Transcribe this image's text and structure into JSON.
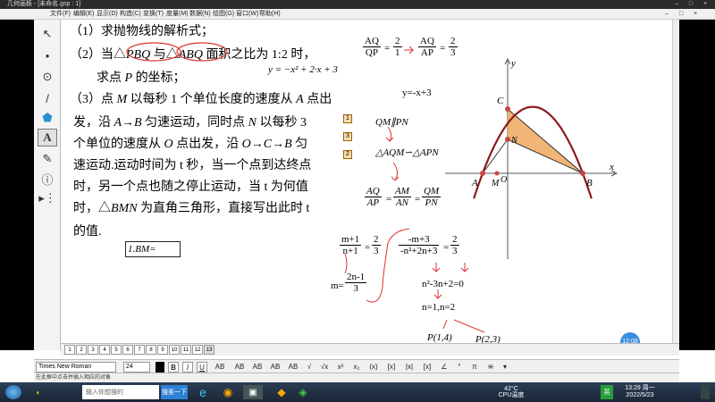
{
  "window": {
    "title": "几何画板 - [未命名.gsp : 1]",
    "controls": [
      "–",
      "□",
      "×"
    ]
  },
  "menu": {
    "items": [
      "文件(F)",
      "编辑(E)",
      "显示(D)",
      "构造(C)",
      "变换(T)",
      "度量(M)",
      "数据(N)",
      "绘图(G)",
      "窗口(W)",
      "帮助(H)"
    ],
    "doc_controls": [
      "–",
      "□",
      "×"
    ]
  },
  "toolbox": {
    "tools": [
      "arrow-tool",
      "point-tool",
      "compass-tool",
      "line-tool",
      "polygon-tool",
      "text-tool",
      "marker-tool",
      "info-tool",
      "custom-tool"
    ],
    "glyphs": [
      "↖",
      "•",
      "⊙",
      "/",
      "⬟",
      "A",
      "✎",
      "ⓘ",
      "▸⋮"
    ]
  },
  "problem": {
    "q1": "（1）求抛物线的解析式；",
    "q2_prefix": "（2）当△",
    "q2_tri1": "PBQ",
    "q2_mid": " 与△",
    "q2_tri2": "ABQ",
    "q2_suffix": " 面积之比为 1:2 时，",
    "q2_line2_a": "求点 ",
    "q2_line2_p": "P",
    "q2_line2_b": " 的坐标；",
    "q3_l1a": "（3）点 ",
    "q3_l1m": "M",
    "q3_l1b": " 以每秒 1 个单位长度的速度从 ",
    "q3_l1c": "A",
    "q3_l1d": " 点出",
    "q3_l2a": "发，沿 ",
    "q3_l2b": "A→B",
    "q3_l2c": " 匀速运动，同时点 ",
    "q3_l2d": "N",
    "q3_l2e": " 以每秒 3",
    "q3_l3a": "个单位的速度从 ",
    "q3_l3b": "O",
    "q3_l3c": " 点出发，沿 ",
    "q3_l3d": "O→C→B",
    "q3_l3e": " 匀",
    "q3_l4": "速运动.运动时间为 t 秒，当一个点到达终点",
    "q3_l5": "时，另一个点也随之停止运动，当 t 为何值",
    "q3_l6a": "时，△",
    "q3_l6b": "BMN",
    "q3_l6c": " 为直角三角形，直接写出此时 t",
    "q3_l7": "的值."
  },
  "equation": "y = −x² + 2·x + 3",
  "handwritten": {
    "aq_qp_num": "AQ",
    "aq_qp_den": "QP",
    "eq1": "=",
    "two": "2",
    "one": "1",
    "aq_ap_num": "AQ",
    "aq_ap_den": "AP",
    "two3_num": "2",
    "two3_den": "3",
    "line_eq": "y=-x+3",
    "parallel": "QM∥PN",
    "similar": "△AQM∽△APN",
    "ratio_a_num": "AQ",
    "ratio_a_den": "AP",
    "ratio_b_num": "AM",
    "ratio_b_den": "AN",
    "ratio_c_num": "QM",
    "ratio_c_den": "PN",
    "m1_num": "m+1",
    "m1_den": "n+1",
    "m1_rhs_num": "2",
    "m1_rhs_den": "3",
    "m2_num": "-m+3",
    "m2_den": "-n²+2n+3",
    "m2_rhs_num": "2",
    "m2_rhs_den": "3",
    "m_eq_lhs": "m=",
    "m_eq_num": "2n-1",
    "m_eq_den": "3",
    "quad": "n²-3n+2=0",
    "roots": "n=1,n=2",
    "p1": "P(1,4)",
    "p2": "P(2,3)"
  },
  "badges": [
    "1",
    "3",
    "2"
  ],
  "input_box": "1.BM=",
  "graph": {
    "labels": {
      "C": "C",
      "N": "N",
      "A": "A",
      "M": "M",
      "O": "O",
      "B": "B",
      "x": "x",
      "y": "y"
    }
  },
  "clock_badge": "12:08",
  "pages": [
    "1",
    "2",
    "3",
    "4",
    "5",
    "6",
    "7",
    "8",
    "9",
    "10",
    "11",
    "12",
    "13"
  ],
  "format_bar": {
    "font": "Times New Roman",
    "size": "24",
    "buttons": [
      "B",
      "I",
      "U",
      "AB",
      "AB",
      "AB",
      "AB",
      "AB",
      "√",
      "√x",
      "x²",
      "x₂",
      "(x)",
      "[x]",
      "|x|",
      "[x]",
      "∠",
      "°",
      "π",
      "≅",
      "▾"
    ]
  },
  "status": "在此框中点击并插入相应的对象",
  "taskbar": {
    "search_input": "输入你想搜的",
    "search_button": "搜索一下",
    "time": "13:29 周一",
    "date": "2022/5/23",
    "temperature": "42°C",
    "cpu": "CPU温度",
    "ime": "英"
  }
}
